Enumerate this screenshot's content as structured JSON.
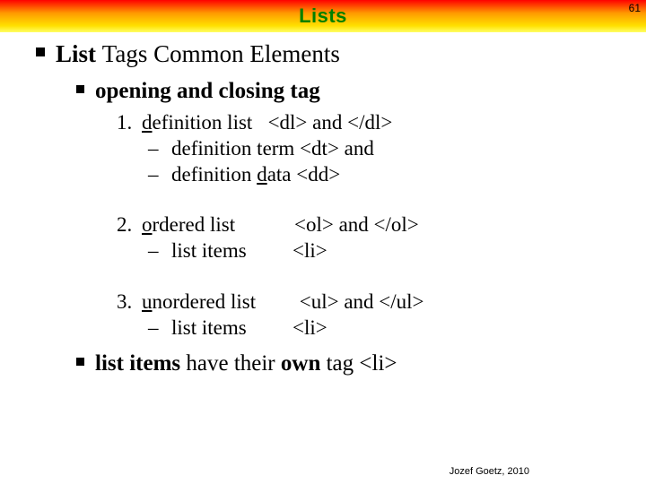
{
  "pageNumber": "61",
  "title": "Lists",
  "heading": {
    "pre": "List ",
    "plain": "Tags Common Elements"
  },
  "sub": {
    "strong": "opening and closing tag"
  },
  "item1": {
    "num": "1.",
    "label_pre": "d",
    "label_rest": "efinition list",
    "tags": "   <dl> and </dl>",
    "dash": "–",
    "d1_text": "definition term <dt> and",
    "d2_pre": "definition ",
    "d2_d": "d",
    "d2_rest": "ata <dd>"
  },
  "item2": {
    "num": "2.",
    "label_pre": "o",
    "label_rest": "rdered list",
    "tags": "<ol> and </ol>",
    "dash": "–",
    "d1_label": "list items",
    "d1_tags": "<li>"
  },
  "item3": {
    "num": "3.",
    "label_pre": "u",
    "label_rest": "nordered list",
    "tags": " <ul> and </ul>",
    "dash": "–",
    "d1_label": "list items",
    "d1_tags": "<li>"
  },
  "closing": {
    "b1": "list items ",
    "plain1": "have their ",
    "b2": "own ",
    "plain2": "tag <li>"
  },
  "footer": "Jozef Goetz, 2010"
}
